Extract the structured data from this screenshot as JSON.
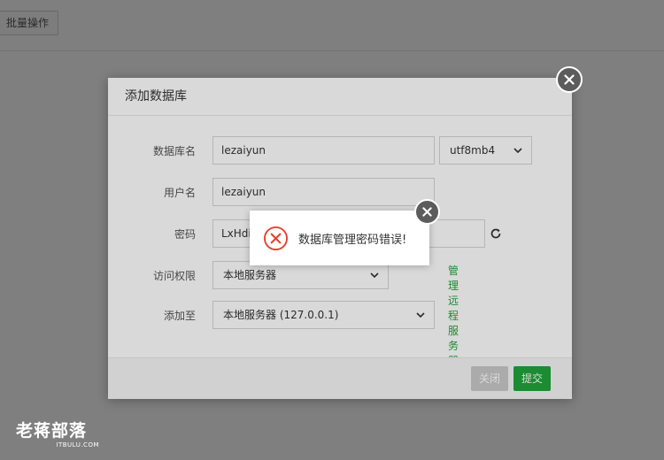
{
  "background": {
    "batch_button": "批量操作"
  },
  "dialog": {
    "title": "添加数据库",
    "fields": {
      "db_name": {
        "label": "数据库名",
        "value": "lezaiyun",
        "charset": "utf8mb4"
      },
      "username": {
        "label": "用户名",
        "value": "lezaiyun"
      },
      "password": {
        "label": "密码",
        "value": "LxHdi"
      },
      "access": {
        "label": "访问权限",
        "value": "本地服务器"
      },
      "add_to": {
        "label": "添加至",
        "value": "本地服务器 (127.0.0.1)",
        "link": "管理远程服务器"
      }
    },
    "buttons": {
      "close": "关闭",
      "submit": "提交"
    }
  },
  "toast": {
    "message": "数据库管理密码错误!",
    "icon": "error-x-icon"
  },
  "watermark": {
    "title": "老蒋部落",
    "subtitle": "ITBULU.COM"
  },
  "colors": {
    "accent_green": "#20a53a",
    "error_red": "#e8432f",
    "overlay": "#7f7f7f"
  }
}
